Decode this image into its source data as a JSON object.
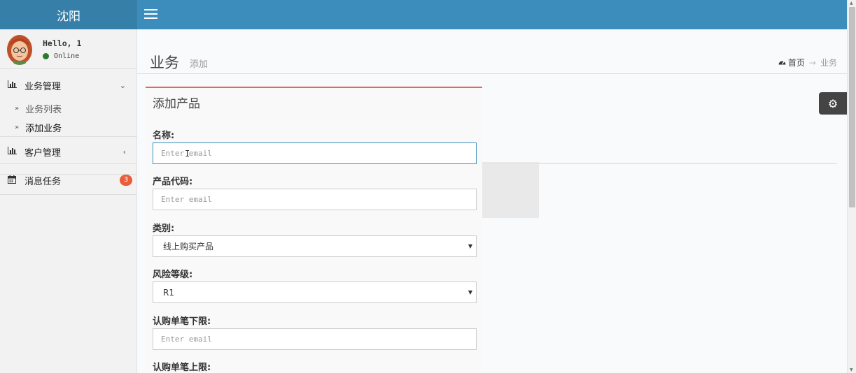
{
  "header": {
    "logo_text": "沈阳"
  },
  "user": {
    "greeting": "Hello, 1",
    "status": "Online"
  },
  "sidebar": {
    "menus": [
      {
        "label": "业务管理",
        "icon": "bar-chart-icon",
        "expanded": true,
        "children": [
          {
            "label": "业务列表"
          },
          {
            "label": "添加业务"
          }
        ]
      },
      {
        "label": "客户管理",
        "icon": "bar-chart-icon",
        "expanded": false
      },
      {
        "label": "消息任务",
        "icon": "calendar-icon",
        "badge": "3"
      }
    ]
  },
  "page": {
    "title": "业务",
    "subtitle": "添加"
  },
  "breadcrumb": {
    "home": "首页",
    "current": "业务"
  },
  "form": {
    "box_title": "添加产品",
    "fields": [
      {
        "label": "名称:",
        "placeholder": "Enter email"
      },
      {
        "label": "产品代码:",
        "placeholder": "Enter email"
      },
      {
        "label": "类别:",
        "value": "线上购买产品"
      },
      {
        "label": "风险等级:",
        "value": "R1"
      },
      {
        "label": "认购单笔下限:",
        "placeholder": "Enter email"
      },
      {
        "label": "认购单笔上限:"
      }
    ]
  },
  "colors": {
    "header": "#3c8dbc",
    "logo_bg": "#367fa9",
    "badge": "#e85e3c",
    "box_accent": "#e06a5a",
    "online": "#2b7a2b"
  }
}
